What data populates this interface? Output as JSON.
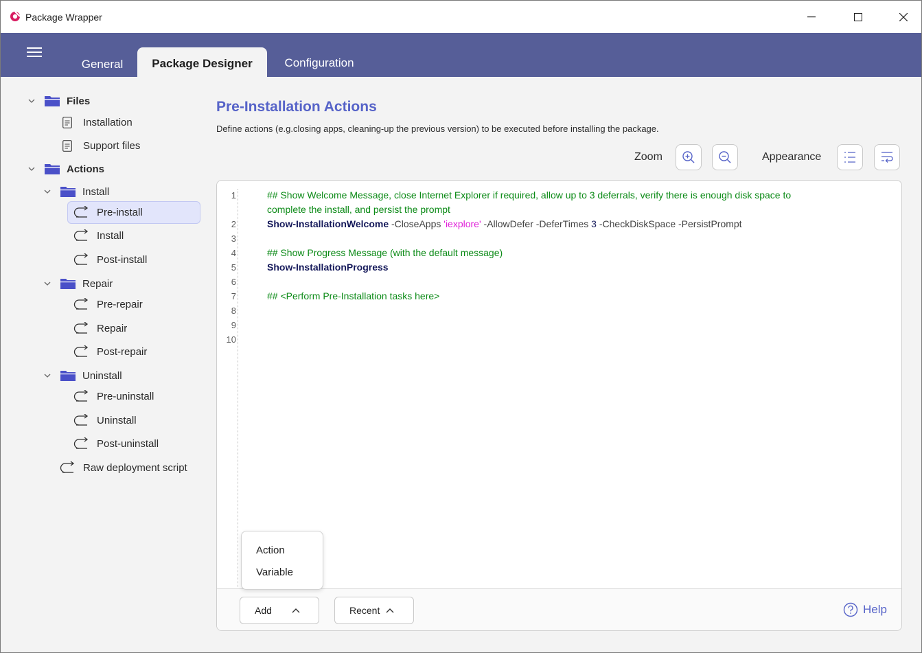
{
  "window": {
    "title": "Package Wrapper",
    "minimize": "—",
    "maximize": "☐",
    "close": "✕"
  },
  "tabs": [
    {
      "label": "General"
    },
    {
      "label": "Package Designer",
      "active": true
    },
    {
      "label": "Configuration"
    }
  ],
  "tree": {
    "files": {
      "label": "Files",
      "items": [
        "Installation",
        "Support files"
      ]
    },
    "actions": {
      "label": "Actions",
      "install": {
        "label": "Install",
        "items": [
          "Pre-install",
          "Install",
          "Post-install"
        ]
      },
      "repair": {
        "label": "Repair",
        "items": [
          "Pre-repair",
          "Repair",
          "Post-repair"
        ]
      },
      "uninstall": {
        "label": "Uninstall",
        "items": [
          "Pre-uninstall",
          "Uninstall",
          "Post-uninstall"
        ]
      },
      "raw": "Raw deployment script"
    },
    "selected": "Pre-install"
  },
  "main": {
    "heading": "Pre-Installation Actions",
    "description": "Define actions (e.g.closing apps, cleaning-up the previous version) to be executed before installing the package.",
    "zoom_label": "Zoom",
    "appearance_label": "Appearance"
  },
  "editor": {
    "line_numbers": [
      "1",
      "2",
      "3",
      "4",
      "5",
      "6",
      "7",
      "8",
      "9",
      "10"
    ],
    "line1a": "## Show Welcome Message, close Internet Explorer if required, allow up to 3 deferrals, verify there is enough disk space to",
    "line1b": "complete the install, and persist the prompt",
    "line2_cmd": "Show-InstallationWelcome",
    "line2_p1": " -CloseApps ",
    "line2_str": "'iexplore'",
    "line2_p2": " -AllowDefer -DeferTimes ",
    "line2_num": "3",
    "line2_p3": " -CheckDiskSpace -PersistPrompt",
    "line4": "## Show Progress Message (with the default message)",
    "line5_cmd": "Show-InstallationProgress",
    "line7": "## <Perform Pre-Installation tasks here>"
  },
  "footer": {
    "add_label": "Add",
    "recent_label": "Recent",
    "help_label": "Help"
  },
  "popup": {
    "items": [
      "Action",
      "Variable"
    ]
  },
  "colors": {
    "accent": "#5663c8",
    "tabbar": "#565e98",
    "comment": "#0b8a16",
    "string": "#e01fd8",
    "keyword": "#15195a"
  }
}
